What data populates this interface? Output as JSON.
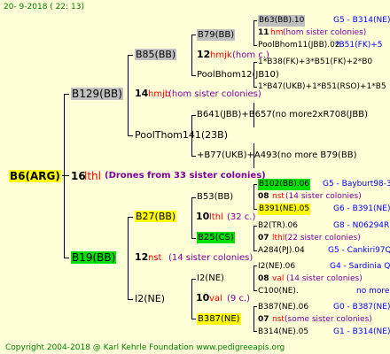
{
  "header": {
    "date": "20-  9-2018 ( 22: 13)"
  },
  "footer": {
    "copyright": "Copyright 2004-2018 @ Karl Kehrle Foundation    www.pedigreeapis.org"
  },
  "root": {
    "name": "B6(ARG)",
    "num": "16",
    "code": "lthl",
    "note": "(Drones from 33 sister colonies)"
  },
  "gen1": {
    "top": {
      "name": "B129(BB)",
      "num": "14",
      "code": "hmjb",
      "note": "(hom sister colonies)"
    },
    "bottom": {
      "name": "B19(BB)",
      "num": "12",
      "code": "nst",
      "note": "(14 sister colonies)"
    }
  },
  "gen2": {
    "b85": "B85(BB)",
    "poolthom": "PoolThom141(23B)",
    "b27": {
      "name": "B27(BB)",
      "num": "10",
      "code": "lthl",
      "note": "(32 c.)"
    },
    "i2a": {
      "name": "I2(NE)",
      "num": "10",
      "code": "val",
      "note": "(9 c.)"
    }
  },
  "gen3": {
    "b79": {
      "name": "B79(BB)",
      "num": "12",
      "code": "hmjk",
      "note": "(hom c.)"
    },
    "poolbhom12": "PoolBhom12(JB10)",
    "b641": "B641(JBB)+B657(no more2xR708(JBB)",
    "b77": "+B77(UKB)+A493(no more B79(BB)",
    "b53": "B53(BB)",
    "b25": "B25(CS)",
    "i2b": "I2(NE)",
    "b387": "B387(NE)"
  },
  "gen4": {
    "row1": {
      "name": "B63(BB).10",
      "right": "G5 - B314(NE)"
    },
    "row2": {
      "num": "11",
      "code": "hm",
      "note": "(hom sister colonies)"
    },
    "row3": {
      "name": "PoolBhom11(JBB).02",
      "right": "*B51(FK)+5"
    },
    "row4": {
      "name": "1*B38(FK)+3*B51(FK)+2*B0"
    },
    "row5": {
      "name": "1*B47(UKB)+1*B51(RSO)+1*B5"
    },
    "row6": {
      "name": "B102(BB).06",
      "right": "G5 - Bayburt98-3"
    },
    "row7": {
      "num": "08",
      "code": "nst",
      "note": "(14 sister colonies)"
    },
    "row8": {
      "name": "B391(NE).05",
      "right": "G6 - B391(NE)"
    },
    "row9": {
      "name": "B2(TR).06",
      "right": "G8 - N06294R"
    },
    "row10": {
      "num": "07",
      "code": "lthl",
      "note": "(22 sister colonies)"
    },
    "row11": {
      "name": "A284(PJ).04",
      "right": "G5 - Cankiri97Q"
    },
    "row12": {
      "name": "I2(NE).06",
      "right": "G4 - Sardinia Q"
    },
    "row13": {
      "num": "08",
      "code": "val",
      "note": "(14 sister colonies)"
    },
    "row14": {
      "name": "C100(NE).",
      "right": "no more"
    },
    "row15": {
      "name": "B387(NE).06",
      "right": "G0 - B387(NE)"
    },
    "row16": {
      "num": "07",
      "code": "nst",
      "note": "(some sister colonies)"
    },
    "row17": {
      "name": "B314(NE).05",
      "right": "G1 - B314(NE)"
    }
  }
}
